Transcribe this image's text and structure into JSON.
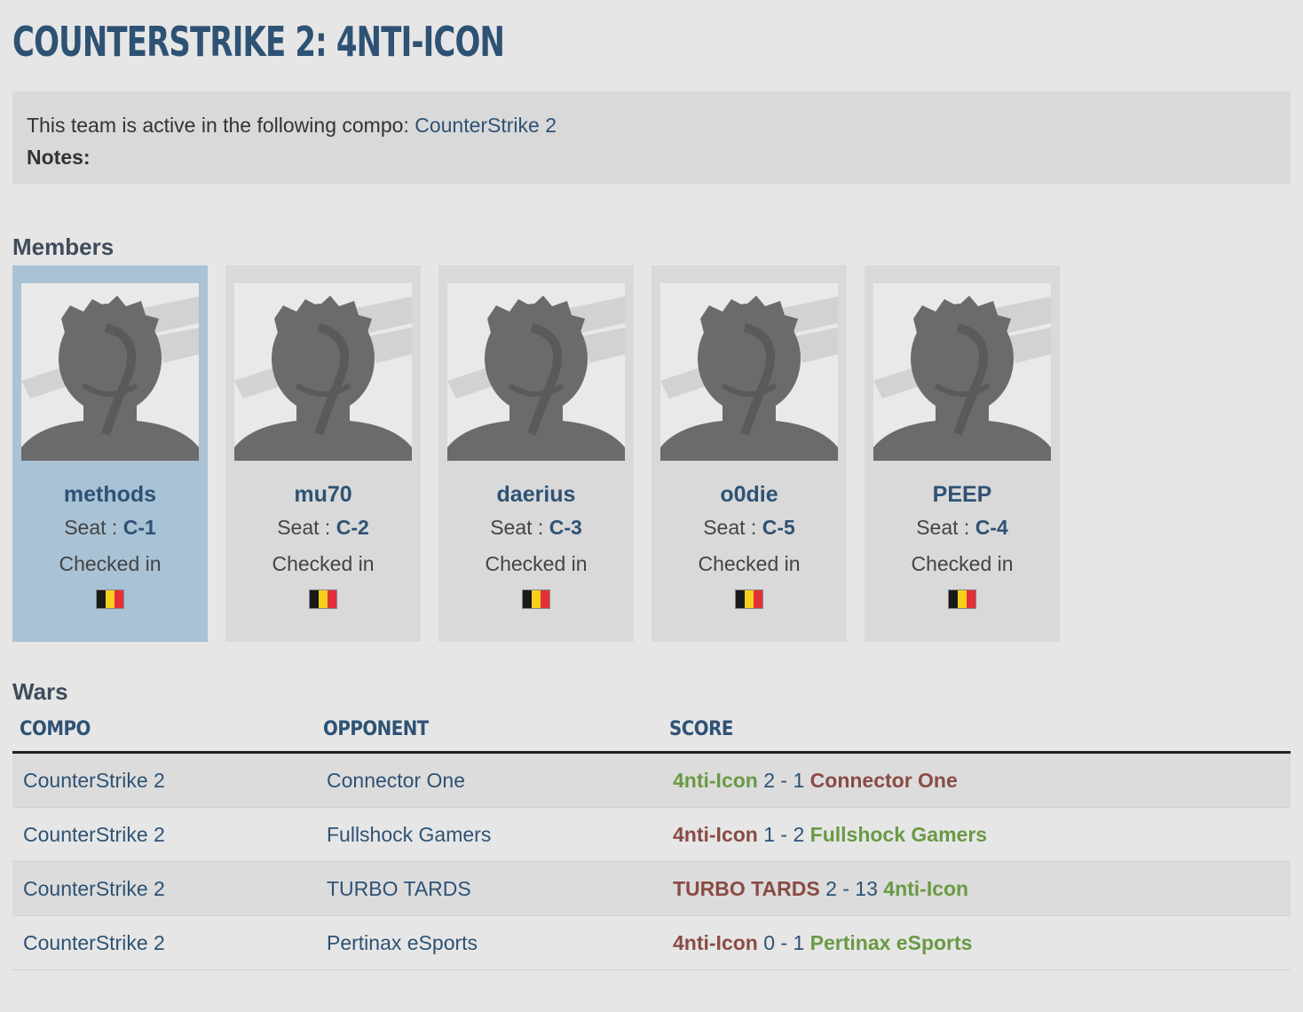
{
  "page": {
    "title": "COUNTERSTRIKE 2: 4NTI-ICON"
  },
  "info": {
    "active_text": "This team is active in the following compo:",
    "compo_link": "CounterStrike 2",
    "notes_label": "Notes:",
    "notes_value": ""
  },
  "members": {
    "heading": "Members",
    "items": [
      {
        "name": "methods",
        "seat_label": "Seat :",
        "seat": "C-1",
        "status": "Checked in",
        "active": true
      },
      {
        "name": "mu70",
        "seat_label": "Seat :",
        "seat": "C-2",
        "status": "Checked in"
      },
      {
        "name": "daerius",
        "seat_label": "Seat :",
        "seat": "C-3",
        "status": "Checked in"
      },
      {
        "name": "o0die",
        "seat_label": "Seat :",
        "seat": "C-5",
        "status": "Checked in"
      },
      {
        "name": "PEEP",
        "seat_label": "Seat :",
        "seat": "C-4",
        "status": "Checked in"
      }
    ],
    "flag_colors": [
      "#1a1a1a",
      "#f5d11e",
      "#e5303a"
    ]
  },
  "wars": {
    "heading": "Wars",
    "columns": [
      "Compo",
      "Opponent",
      "Score"
    ],
    "rows": [
      {
        "compo": "CounterStrike 2",
        "opponent": "Connector One",
        "team_a": "4nti-Icon",
        "score": "2 - 1",
        "team_b": "Connector One",
        "a_result": "win",
        "b_result": "lose"
      },
      {
        "compo": "CounterStrike 2",
        "opponent": "Fullshock Gamers",
        "team_a": "4nti-Icon",
        "score": "1 - 2",
        "team_b": "Fullshock Gamers",
        "a_result": "lose",
        "b_result": "win"
      },
      {
        "compo": "CounterStrike 2",
        "opponent": "TURBO TARDS",
        "team_a": "TURBO TARDS",
        "score": "2 - 13",
        "team_b": "4nti-Icon",
        "a_result": "lose",
        "b_result": "win"
      },
      {
        "compo": "CounterStrike 2",
        "opponent": "Pertinax eSports",
        "team_a": "4nti-Icon",
        "score": "0 - 1",
        "team_b": "Pertinax eSports",
        "a_result": "lose",
        "b_result": "win"
      }
    ]
  },
  "colors": {
    "win": "#6a9a45",
    "lose": "#8a4b45",
    "link": "#2e5274"
  }
}
